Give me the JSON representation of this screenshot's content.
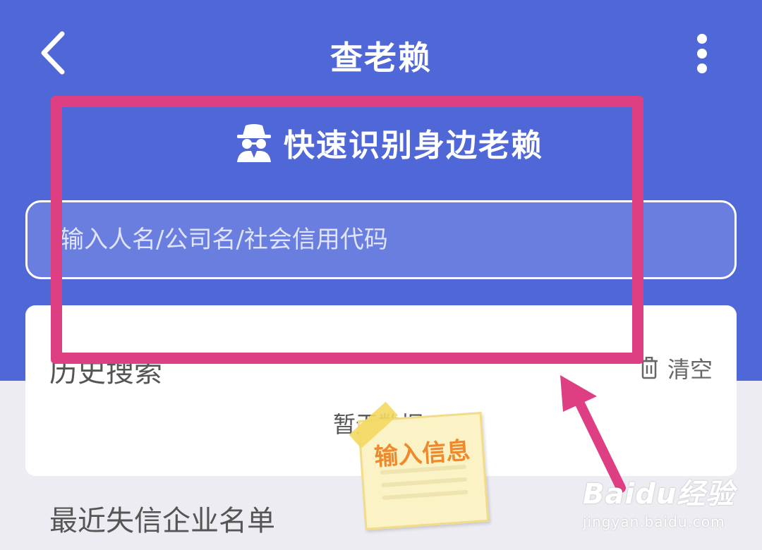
{
  "header": {
    "title": "查老赖",
    "back_icon": "chevron-left-icon",
    "more_icon": "more-vertical-icon"
  },
  "hero": {
    "slogan_icon": "spy-icon",
    "slogan": "快速识别身边老赖",
    "search_placeholder": "输入人名/公司名/社会信用代码"
  },
  "history": {
    "title": "历史搜索",
    "clear_label": "清空",
    "clear_icon": "trash-icon",
    "empty_text": "暂无数据"
  },
  "recent": {
    "title": "最近失信企业名单"
  },
  "annotation": {
    "sticky_note": "输入信息",
    "highlight_color": "#de3f83"
  },
  "watermark": {
    "logo": "Baidu经验",
    "url": "jingyan.baidu.com"
  },
  "colors": {
    "primary": "#5067d8",
    "background": "#ececf2",
    "annotation": "#de3f83",
    "sticky_text": "#ee8a2b"
  }
}
